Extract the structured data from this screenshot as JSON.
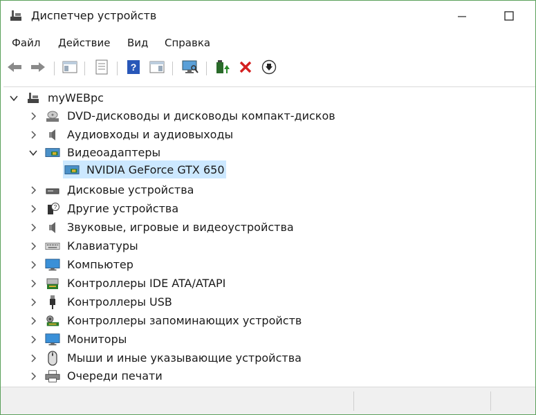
{
  "window": {
    "title": "Диспетчер устройств",
    "title_icon": "device-manager-icon",
    "controls": [
      "minimize-icon",
      "maximize-icon"
    ]
  },
  "menu": {
    "items": [
      {
        "label": "Файл"
      },
      {
        "label": "Действие"
      },
      {
        "label": "Вид"
      },
      {
        "label": "Справка"
      }
    ]
  },
  "toolbar": {
    "buttons": [
      {
        "icon": "back-arrow-icon"
      },
      {
        "icon": "forward-arrow-icon"
      },
      {
        "icon": "show-hide-console-tree-icon"
      },
      {
        "icon": "properties-icon"
      },
      {
        "icon": "help-icon"
      },
      {
        "icon": "show-action-pane-icon"
      },
      {
        "icon": "scan-hardware-icon"
      },
      {
        "icon": "update-driver-icon"
      },
      {
        "icon": "uninstall-device-icon"
      },
      {
        "icon": "disable-device-icon"
      }
    ]
  },
  "tree": {
    "root": {
      "label": "myWEBpc",
      "icon": "computer-root-icon",
      "expanded": true
    },
    "nodes": [
      {
        "label": "DVD-дисководы и дисководы компакт-дисков",
        "icon": "dvd-drive-icon",
        "expanded": false
      },
      {
        "label": "Аудиовходы и аудиовыходы",
        "icon": "speaker-icon",
        "expanded": false
      },
      {
        "label": "Видеоадаптеры",
        "icon": "display-adapter-icon",
        "expanded": true,
        "children": [
          {
            "label": "NVIDIA GeForce GTX 650",
            "icon": "display-adapter-icon",
            "selected": true
          }
        ]
      },
      {
        "label": "Дисковые устройства",
        "icon": "disk-drive-icon",
        "expanded": false
      },
      {
        "label": "Другие устройства",
        "icon": "unknown-device-icon",
        "expanded": false
      },
      {
        "label": "Звуковые, игровые и видеоустройства",
        "icon": "speaker-icon",
        "expanded": false
      },
      {
        "label": "Клавиатуры",
        "icon": "keyboard-icon",
        "expanded": false
      },
      {
        "label": "Компьютер",
        "icon": "monitor-icon",
        "expanded": false
      },
      {
        "label": "Контроллеры IDE ATA/ATAPI",
        "icon": "ide-controller-icon",
        "expanded": false
      },
      {
        "label": "Контроллеры USB",
        "icon": "usb-icon",
        "expanded": false
      },
      {
        "label": "Контроллеры запоминающих устройств",
        "icon": "storage-controller-icon",
        "expanded": false
      },
      {
        "label": "Мониторы",
        "icon": "monitor-icon",
        "expanded": false
      },
      {
        "label": "Мыши и иные указывающие устройства",
        "icon": "mouse-icon",
        "expanded": false
      },
      {
        "label": "Очереди печати",
        "icon": "printer-icon",
        "expanded": false
      }
    ]
  },
  "colors": {
    "selection": "#cce8ff",
    "window_border": "#5aa05a",
    "uninstall_red": "#d42020",
    "update_green": "#2a8a2a",
    "help_blue": "#2857b8"
  }
}
